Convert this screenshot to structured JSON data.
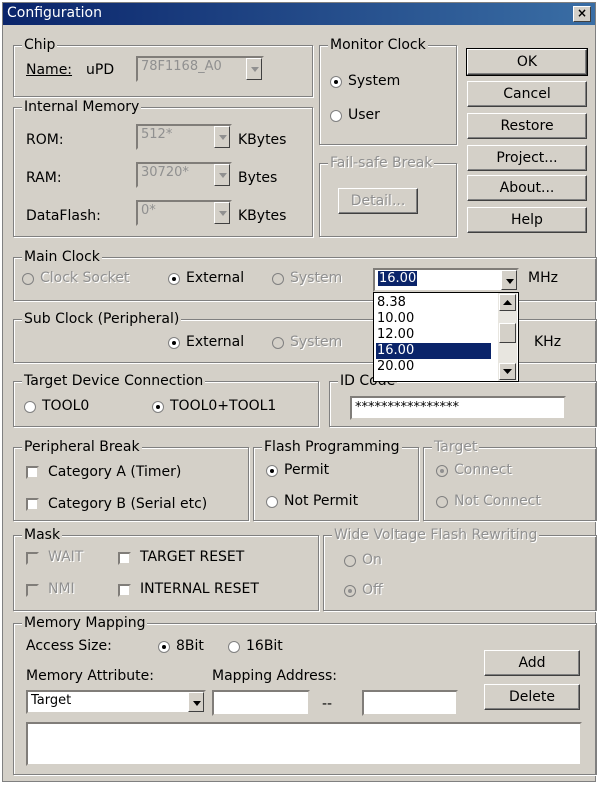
{
  "window": {
    "title": "Configuration",
    "close": "×"
  },
  "chip": {
    "legend": "Chip",
    "name_label": "Name:",
    "prefix": "uPD",
    "value": "78F1168_A0"
  },
  "internal_memory": {
    "legend": "Internal Memory",
    "rom": {
      "label": "ROM:",
      "value": "512*",
      "unit": "KBytes"
    },
    "ram": {
      "label": "RAM:",
      "value": "30720*",
      "unit": "Bytes"
    },
    "dataflash": {
      "label": "DataFlash:",
      "value": "0*",
      "unit": "KBytes"
    }
  },
  "monitor_clock": {
    "legend": "Monitor Clock",
    "system": "System",
    "user": "User"
  },
  "failsafe": {
    "legend": "Fail-safe Break",
    "detail": "Detail..."
  },
  "buttons": {
    "ok": "OK",
    "cancel": "Cancel",
    "restore": "Restore",
    "project": "Project...",
    "about": "About...",
    "help": "Help"
  },
  "main_clock": {
    "legend": "Main Clock",
    "socket": "Clock Socket",
    "external": "External",
    "system": "System",
    "value": "16.00",
    "unit": "MHz"
  },
  "dropdown": {
    "options": [
      "8.38",
      "10.00",
      "12.00",
      "16.00",
      "20.00"
    ],
    "selected_index": 3
  },
  "sub_clock": {
    "legend": "Sub Clock (Peripheral)",
    "external": "External",
    "system": "System",
    "unit": "KHz"
  },
  "target_conn": {
    "legend": "Target Device Connection",
    "tool0": "TOOL0",
    "tool0_tool1": "TOOL0+TOOL1"
  },
  "id_code": {
    "legend": "ID Code",
    "value": "****************"
  },
  "peripheral_break": {
    "legend": "Peripheral Break",
    "cat_a": "Category A (Timer)",
    "cat_b": "Category B (Serial etc)"
  },
  "flash_programming": {
    "legend": "Flash Programming",
    "permit": "Permit",
    "not_permit": "Not Permit"
  },
  "target": {
    "legend": "Target",
    "connect": "Connect",
    "not_connect": "Not Connect"
  },
  "mask": {
    "legend": "Mask",
    "wait": "WAIT",
    "nmi": "NMI",
    "target_reset": "TARGET RESET",
    "internal_reset": "INTERNAL RESET"
  },
  "wide_voltage": {
    "legend": "Wide Voltage Flash Rewriting",
    "on": "On",
    "off": "Off"
  },
  "memory_mapping": {
    "legend": "Memory Mapping",
    "access_size": "Access Size:",
    "bit8": "8Bit",
    "bit16": "16Bit",
    "attribute_label": "Memory Attribute:",
    "mapping_label": "Mapping Address:",
    "attribute_value": "Target",
    "separator": "--",
    "add": "Add",
    "delete": "Delete"
  }
}
